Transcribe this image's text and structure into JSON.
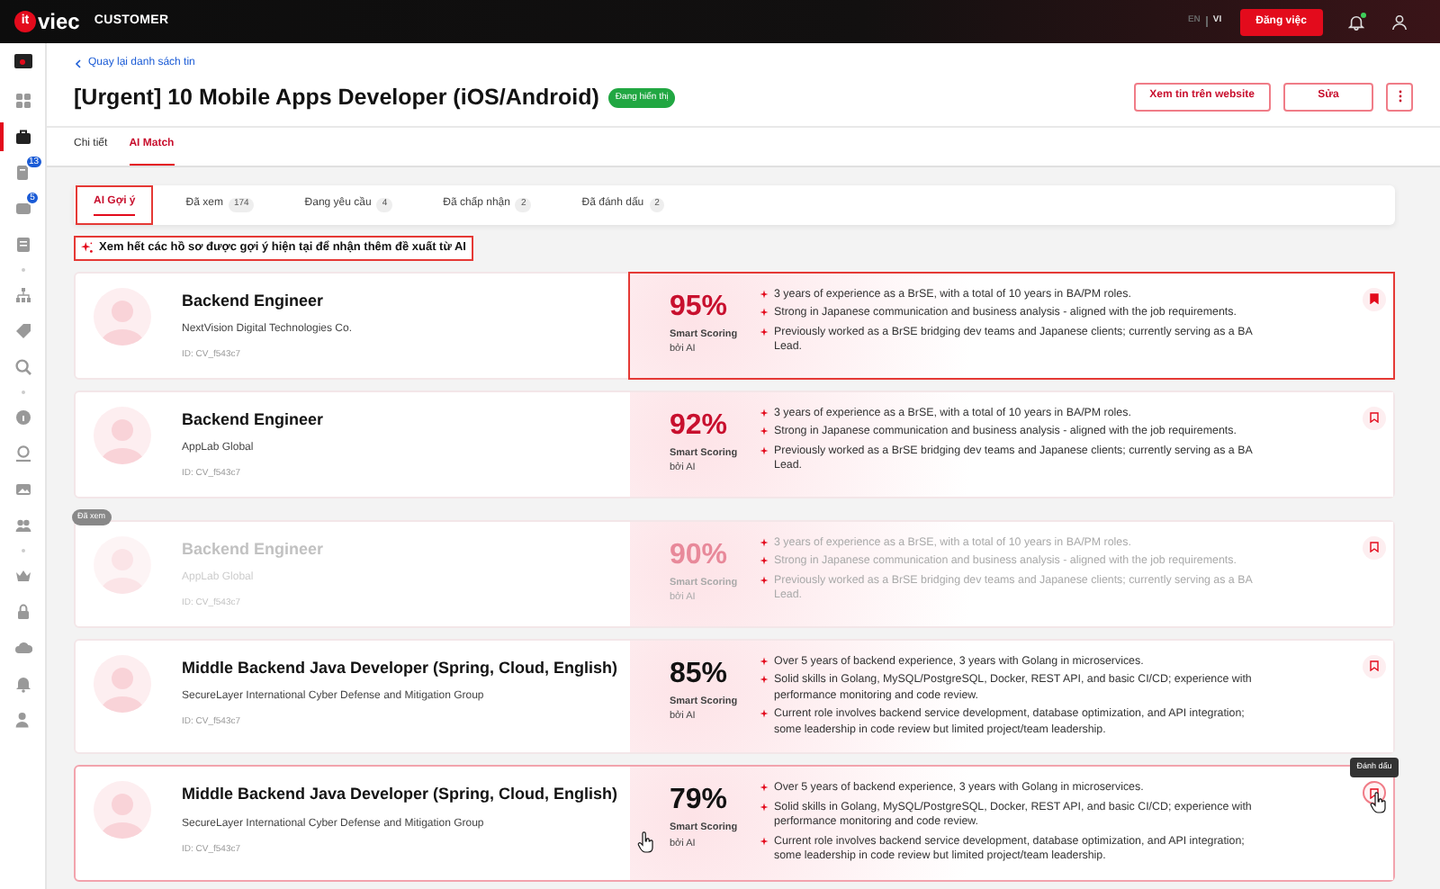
{
  "topbar": {
    "brand_prefix": "it",
    "brand_name": "viec",
    "product": "CUSTOMER",
    "languages": [
      {
        "label": "EN",
        "selected": false
      },
      {
        "label": "VI",
        "selected": true
      }
    ],
    "post_button": "Đăng việc",
    "notification_dot": true
  },
  "sidebar": {
    "groups": [
      [
        {
          "selected": false
        },
        {
          "selected": true
        },
        {
          "selected": false,
          "badge": "13"
        },
        {
          "selected": false,
          "badge": "5"
        },
        {
          "selected": false
        }
      ],
      [
        {
          "selected": false
        },
        {
          "selected": false
        },
        {
          "selected": false
        }
      ],
      [
        {
          "selected": false
        },
        {
          "selected": false
        },
        {
          "selected": false
        },
        {
          "selected": false
        }
      ],
      [
        {
          "selected": false
        },
        {
          "selected": false
        },
        {
          "selected": false
        },
        {
          "selected": false
        },
        {
          "selected": false
        }
      ]
    ]
  },
  "header": {
    "back_link": "Quay lại danh sách tin",
    "title": "[Urgent] 10 Mobile Apps Developer (iOS/Android)",
    "status": "Đang hiển thị",
    "actions": [
      "Xem tin trên website",
      "Sửa"
    ]
  },
  "tabs": [
    {
      "label": "Chi tiết",
      "selected": false
    },
    {
      "label": "AI Match",
      "selected": true
    }
  ],
  "subtabs": [
    {
      "label": "AI Gợi ý",
      "selected": true,
      "highlighted": true
    },
    {
      "label": "Đã xem",
      "count": "174",
      "selected": false,
      "highlighted": false
    },
    {
      "label": "Đang yêu cầu",
      "count": "4",
      "selected": false,
      "highlighted": false
    },
    {
      "label": "Đã chấp nhận",
      "count": "2",
      "selected": false,
      "highlighted": false
    },
    {
      "label": "Đã đánh dấu",
      "count": "2",
      "selected": false,
      "highlighted": false
    }
  ],
  "banner": {
    "text": "Xem hết các hồ sơ được gợi ý hiện tại để nhận thêm đề xuất từ AI",
    "highlighted": true
  },
  "candidates": [
    {
      "title": "Backend Engineer",
      "company": "NextVision Digital Technologies Co.",
      "id": "ID: CV_f543c7",
      "score": "95%",
      "color": "#c8102e",
      "score_label": "Smart Scoring",
      "score_sub": "bởi AI",
      "bullets": [
        "3 years of experience as a BrSE, with a total of 10 years in BA/PM roles.",
        "Strong in Japanese communication and business analysis - aligned with the job requirements.",
        "Previously worked as a BrSE bridging dev teams and Japanese clients; currently serving as a BA Lead."
      ],
      "bookmarked": true,
      "seen": false,
      "hovered": false,
      "highlighted": true
    },
    {
      "title": "Backend Engineer",
      "company": "AppLab Global",
      "id": "ID: CV_f543c7",
      "score": "92%",
      "color": "#c8102e",
      "score_label": "Smart Scoring",
      "score_sub": "bởi AI",
      "bullets": [
        "3 years of experience as a BrSE, with a total of 10 years in BA/PM roles.",
        "Strong in Japanese communication and business analysis - aligned with the job requirements.",
        "Previously worked as a BrSE bridging dev teams and Japanese clients; currently serving as a BA Lead."
      ],
      "bookmarked": false,
      "seen": false,
      "hovered": false,
      "highlighted": false
    },
    {
      "title": "Backend Engineer",
      "company": "AppLab Global",
      "id": "ID: CV_f543c7",
      "score": "90%",
      "color": "#e8899a",
      "score_label": "Smart Scoring",
      "score_sub": "bởi AI",
      "bullets": [
        "3 years of experience as a BrSE, with a total of 10 years in BA/PM roles.",
        "Strong in Japanese communication and business analysis - aligned with the job requirements.",
        "Previously worked as a BrSE bridging dev teams and Japanese clients; currently serving as a BA Lead."
      ],
      "bookmarked": false,
      "seen": true,
      "seen_label": "Đã xem",
      "hovered": false,
      "highlighted": false
    },
    {
      "title": "Middle Backend Java Developer (Spring, Cloud, English)",
      "company": "SecureLayer International Cyber Defense and Mitigation Group",
      "id": "ID: CV_f543c7",
      "score": "85%",
      "color": "#121212",
      "score_label": "Smart Scoring",
      "score_sub": "bởi AI",
      "bullets": [
        "Over 5 years of backend experience, 3 years with Golang in microservices.",
        "Solid skills in Golang, MySQL/PostgreSQL, Docker, REST API, and basic CI/CD; experience with performance monitoring and code review.",
        "Current role involves backend service development, database optimization, and API integration; some leadership in code review but limited project/team leadership."
      ],
      "bookmarked": false,
      "seen": false,
      "hovered": false,
      "highlighted": false
    },
    {
      "title": "Middle Backend Java Developer (Spring, Cloud, English)",
      "company": "SecureLayer International Cyber Defense and Mitigation Group",
      "id": "ID: CV_f543c7",
      "score": "79%",
      "color": "#121212",
      "score_label": "Smart Scoring",
      "score_sub": "bởi AI",
      "bullets": [
        "Over 5 years of backend experience, 3 years with Golang in microservices.",
        "Solid skills in Golang, MySQL/PostgreSQL, Docker, REST API, and basic CI/CD; experience with performance monitoring and code review.",
        "Current role involves backend service development, database optimization, and API integration; some leadership in code review but limited project/team leadership."
      ],
      "bookmarked": false,
      "seen": false,
      "hovered": true,
      "tooltip": "Đánh dấu",
      "highlighted": false
    }
  ]
}
